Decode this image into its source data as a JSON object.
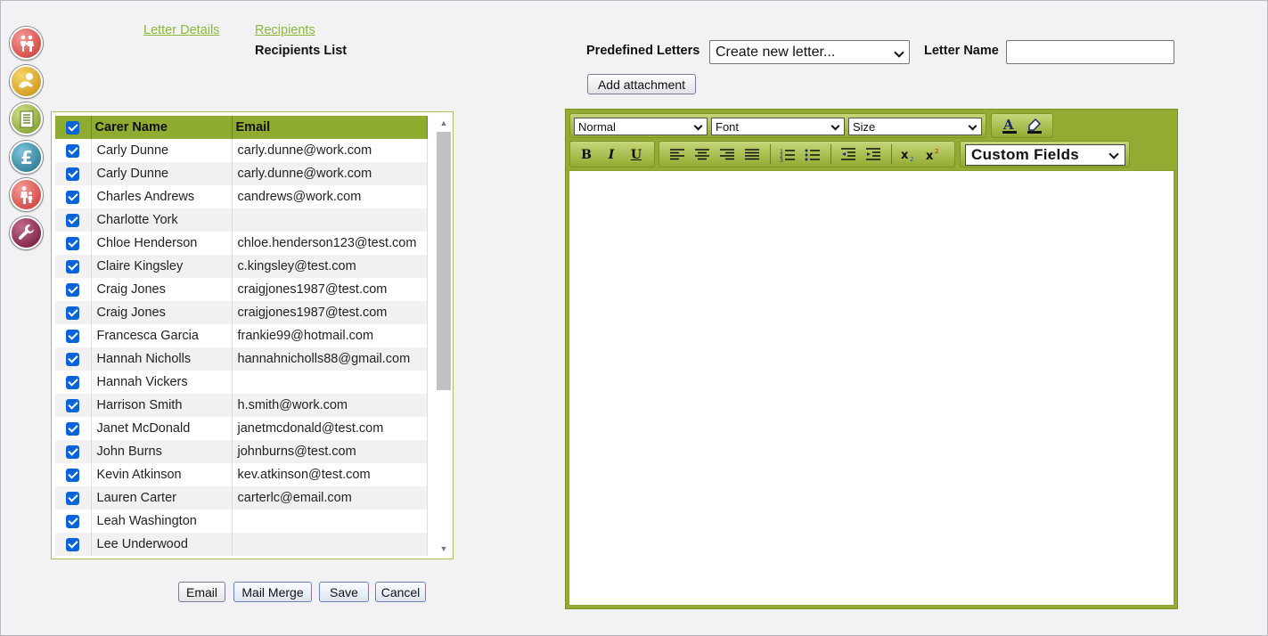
{
  "colors": {
    "accent_green": "#8fab30",
    "link_green": "#8bb83a",
    "checkbox_blue": "#0a63d8"
  },
  "side_icons": [
    {
      "icon": "family-icon",
      "color": "#d9453f"
    },
    {
      "icon": "baby-icon",
      "color": "#e0a611"
    },
    {
      "icon": "document-icon",
      "color": "#8fae2f"
    },
    {
      "icon": "pound-icon",
      "color": "#2c86a3"
    },
    {
      "icon": "parent-child-icon",
      "color": "#e0463b"
    },
    {
      "icon": "wrench-icon",
      "color": "#8c1e4a"
    }
  ],
  "nav": {
    "letter_details": "Letter Details",
    "recipients": "Recipients",
    "recipients_list": "Recipients List"
  },
  "grid": {
    "headers": {
      "name": "Carer Name",
      "email": "Email"
    },
    "rows": [
      {
        "name": "Carly Dunne",
        "email": "carly.dunne@work.com"
      },
      {
        "name": "Carly Dunne",
        "email": "carly.dunne@work.com"
      },
      {
        "name": "Charles Andrews",
        "email": "candrews@work.com"
      },
      {
        "name": "Charlotte York",
        "email": ""
      },
      {
        "name": "Chloe Henderson",
        "email": "chloe.henderson123@test.com"
      },
      {
        "name": "Claire Kingsley",
        "email": "c.kingsley@test.com"
      },
      {
        "name": "Craig Jones",
        "email": "craigjones1987@test.com"
      },
      {
        "name": "Craig Jones",
        "email": "craigjones1987@test.com"
      },
      {
        "name": "Francesca Garcia",
        "email": "frankie99@hotmail.com"
      },
      {
        "name": "Hannah Nicholls",
        "email": "hannahnicholls88@gmail.com"
      },
      {
        "name": "Hannah Vickers",
        "email": ""
      },
      {
        "name": "Harrison Smith",
        "email": "h.smith@work.com"
      },
      {
        "name": "Janet McDonald",
        "email": "janetmcdonald@test.com"
      },
      {
        "name": "John Burns",
        "email": "johnburns@test.com"
      },
      {
        "name": "Kevin Atkinson",
        "email": "kev.atkinson@test.com"
      },
      {
        "name": "Lauren Carter",
        "email": "carterlc@email.com"
      },
      {
        "name": "Leah Washington",
        "email": ""
      },
      {
        "name": "Lee Underwood",
        "email": ""
      }
    ]
  },
  "buttons": {
    "email": "Email",
    "mail_merge": "Mail Merge",
    "save": "Save",
    "cancel": "Cancel"
  },
  "letter": {
    "predefined_label": "Predefined Letters",
    "predefined_value": "Create new letter...",
    "name_label": "Letter Name",
    "name_value": "",
    "add_attachment": "Add attachment"
  },
  "editor": {
    "format_value": "Normal",
    "font_value": "Font",
    "size_value": "Size",
    "custom_fields": "Custom Fields",
    "bold": "B",
    "italic": "I",
    "underline": "U"
  }
}
